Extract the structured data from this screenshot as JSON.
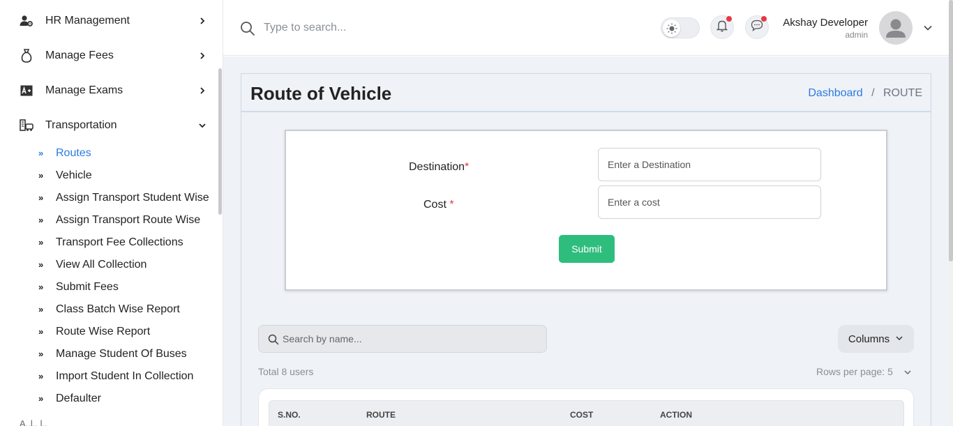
{
  "sidebar": {
    "menu": [
      {
        "label": "HR Management",
        "icon": "user-gear-icon",
        "expanded": false
      },
      {
        "label": "Manage Fees",
        "icon": "money-bag-icon",
        "expanded": false
      },
      {
        "label": "Manage Exams",
        "icon": "exam-board-icon",
        "expanded": false
      },
      {
        "label": "Transportation",
        "icon": "bus-building-icon",
        "expanded": true
      }
    ],
    "transport_items": [
      {
        "label": "Routes",
        "active": true
      },
      {
        "label": "Vehicle",
        "active": false
      },
      {
        "label": "Assign Transport Student Wise",
        "active": false
      },
      {
        "label": "Assign Transport Route Wise",
        "active": false
      },
      {
        "label": "Transport Fee Collections",
        "active": false
      },
      {
        "label": "View All Collection",
        "active": false
      },
      {
        "label": "Submit Fees",
        "active": false
      },
      {
        "label": "Class Batch Wise Report",
        "active": false
      },
      {
        "label": "Route Wise Report",
        "active": false
      },
      {
        "label": "Manage Student Of Buses",
        "active": false
      },
      {
        "label": "Import Student In Collection",
        "active": false
      },
      {
        "label": "Defaulter",
        "active": false
      }
    ],
    "cutoff_label": "A..l.. l.."
  },
  "topbar": {
    "search_placeholder": "Type to search...",
    "user_name": "Akshay Developer",
    "user_role": "admin",
    "theme": "light",
    "notifications_dot": true,
    "messages_dot": true
  },
  "page": {
    "title": "Route of Vehicle",
    "breadcrumb_home": "Dashboard",
    "breadcrumb_separator": "/",
    "breadcrumb_current": "ROUTE"
  },
  "form": {
    "destination_label": "Destination",
    "destination_placeholder": "Enter a Destination",
    "cost_label": "Cost",
    "cost_placeholder": "Enter a cost",
    "required_mark": "*",
    "submit_label": "Submit"
  },
  "table": {
    "search_placeholder": "Search by name...",
    "columns_label": "Columns",
    "total_text": "Total 8 users",
    "rows_per_page_text": "Rows per page: 5",
    "headers": [
      "S.NO.",
      "ROUTE",
      "COST",
      "ACTION"
    ]
  },
  "colors": {
    "accent_blue": "#2d7be0",
    "submit_green": "#2fbd7e",
    "notify_red": "#e53946",
    "main_bg": "#eff2f7"
  }
}
